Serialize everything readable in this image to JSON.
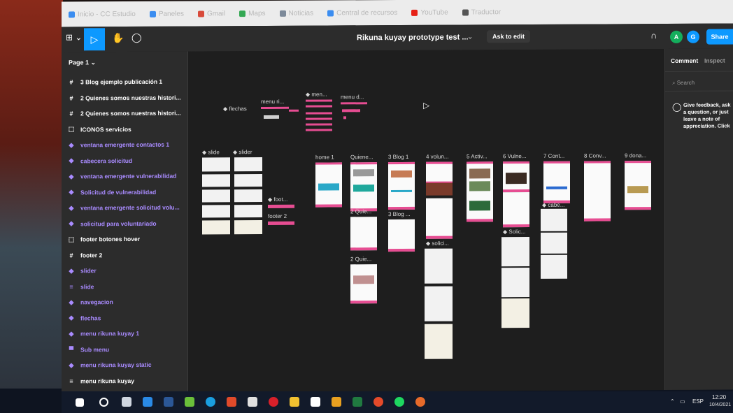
{
  "bookmarks": [
    {
      "label": "Inicio - CC Estudio",
      "color": "#3b8df0"
    },
    {
      "label": "Paneles",
      "color": "#3b8df0"
    },
    {
      "label": "Gmail",
      "color": "#d84a3a"
    },
    {
      "label": "Maps",
      "color": "#34a853"
    },
    {
      "label": "Noticias",
      "color": "#7d8a9a"
    },
    {
      "label": "Central de recursos",
      "color": "#3b8df0"
    },
    {
      "label": "YouTube",
      "color": "#e62117"
    },
    {
      "label": "Traductor",
      "color": "#555555"
    }
  ],
  "toolbar": {
    "menu_label": "⊞ ⌄",
    "file_title": "Rikuna kuyay prototype test ...",
    "title_chevron": "⌄",
    "ask_to_edit": "Ask to edit",
    "avatar_a": "A",
    "avatar_g": "G",
    "share": "Share",
    "avatar_a_color": "#14ae5c",
    "avatar_g_color": "#0d99ff"
  },
  "layers_panel": {
    "page_selector": "Page 1 ⌄",
    "items": [
      {
        "icon": "#",
        "label": "3 Blog ejemplo publicación 1",
        "color": "#ffffff"
      },
      {
        "icon": "#",
        "label": "2 Quienes somos nuestras histori...",
        "color": "#ffffff"
      },
      {
        "icon": "#",
        "label": "2 Quienes somos nuestras histori...",
        "color": "#ffffff"
      },
      {
        "icon": "⬚",
        "label": "ICONOS servicios",
        "color": "#ffffff"
      },
      {
        "icon": "◆",
        "label": "ventana emergente contactos 1",
        "color": "#a98bff"
      },
      {
        "icon": "◆",
        "label": "cabecera solicitud",
        "color": "#a98bff"
      },
      {
        "icon": "◆",
        "label": "ventana emergente vulnerabilidad",
        "color": "#a98bff"
      },
      {
        "icon": "◆",
        "label": "Solicitud de vulnerabilidad",
        "color": "#a98bff"
      },
      {
        "icon": "◆",
        "label": "ventana emergente solicitud volu...",
        "color": "#a98bff"
      },
      {
        "icon": "◆",
        "label": "solicitud para voluntariado",
        "color": "#a98bff"
      },
      {
        "icon": "⬚",
        "label": "footer botones hover",
        "color": "#ffffff"
      },
      {
        "icon": "#",
        "label": "footer 2",
        "color": "#ffffff"
      },
      {
        "icon": "◆",
        "label": "slider",
        "color": "#a98bff"
      },
      {
        "icon": "≡",
        "label": "slide",
        "color": "#a98bff"
      },
      {
        "icon": "◆",
        "label": "navegacion",
        "color": "#a98bff"
      },
      {
        "icon": "◆",
        "label": "flechas",
        "color": "#a98bff"
      },
      {
        "icon": "◆",
        "label": "menu rikuna kuyay 1",
        "color": "#a98bff"
      },
      {
        "icon": "▀",
        "label": "Sub menu",
        "color": "#a98bff"
      },
      {
        "icon": "◆",
        "label": "menu rikuna kuyay static",
        "color": "#a98bff"
      },
      {
        "icon": "≡",
        "label": "menu rikuna kuyay",
        "color": "#ffffff"
      }
    ]
  },
  "canvas": {
    "labels": {
      "flechas": "◆ flechas",
      "menu_ri": "menu ri...",
      "menu_top": "◆ men...",
      "menu_d": "menu d...",
      "slide": "◆ slide",
      "slider": "◆ slider",
      "home": "home 1",
      "quienes": "Quiene...",
      "blog3": "3 Blog 1",
      "volunt": "4 volun...",
      "activ": "5 Activ...",
      "vulne": "6 Vulne...",
      "cont": "7 Cont...",
      "conv": "8 Conv...",
      "dona": "9 dona...",
      "foot": "◆ foot...",
      "footer2": "footer 2",
      "quie2": "2 Quie...",
      "blog3b": "3 Blog ...",
      "solici": "◆ solici...",
      "solic": "◆ Solic...",
      "cabe": "◆ cabe...",
      "quie2b": "2 Quie..."
    }
  },
  "right_panel": {
    "tab_comment": "Comment",
    "tab_inspect": "Inspect",
    "search_placeholder": "Search",
    "hint": "Give feedback, ask a question, or just leave a note of appreciation. Click anywhere in the file to leave a comment."
  },
  "taskbar": {
    "lang": "ESP",
    "time": "12:20",
    "date": "10/4/2021",
    "tray_chevron": "⌃"
  }
}
